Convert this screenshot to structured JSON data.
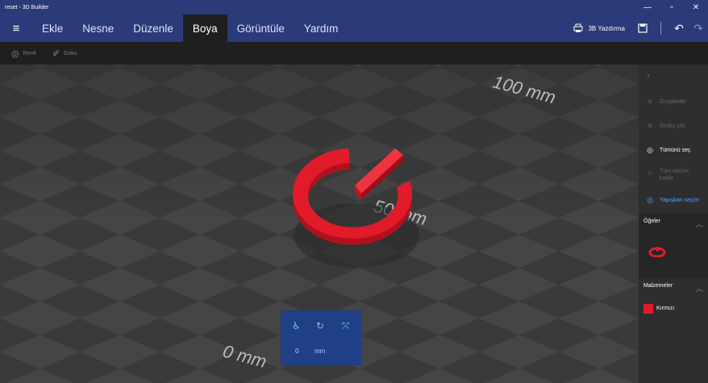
{
  "window": {
    "title": "reset - 3D Builder",
    "min": "—",
    "max": "▫",
    "close": "✕"
  },
  "menu": {
    "items": [
      "Ekle",
      "Nesne",
      "Düzenle",
      "Boya",
      "Görüntüle",
      "Yardım"
    ],
    "active_index": 3,
    "print_label": "3B Yazdırma"
  },
  "toolbar": {
    "color_label": "Renk",
    "texture_label": "Doku"
  },
  "viewport": {
    "ruler_top": "100 mm",
    "ruler_mid": "50 mm",
    "ruler_bottom": "0 mm"
  },
  "gizmo": {
    "value": "0",
    "unit": "mm"
  },
  "sidebar": {
    "group_label": "Gruplandır",
    "ungroup_label": "Grubu çöz",
    "select_all_label": "Tümünü seç",
    "deselect_line1": "Tüm seçimi",
    "deselect_line2": "kaldır",
    "sticky_label": "Yapışkan seçim",
    "items_header": "Öğeler",
    "materials_header": "Malzemeler",
    "material_name": "Kırmızı"
  },
  "colors": {
    "accent": "#2b3a78",
    "material_red": "#e11b2a",
    "highlight_blue": "#4aa3ff"
  }
}
